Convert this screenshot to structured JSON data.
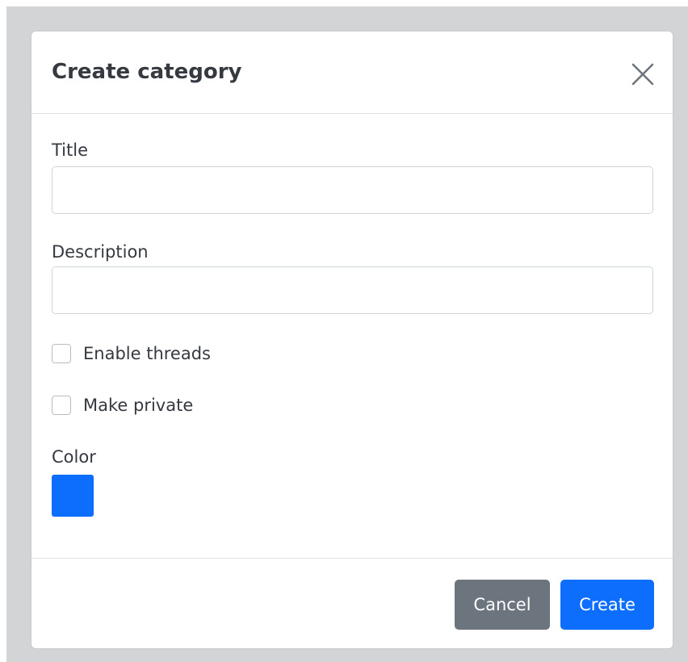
{
  "dialog": {
    "title": "Create category",
    "close_icon": "close-icon"
  },
  "form": {
    "title_label": "Title",
    "title_value": "",
    "description_label": "Description",
    "description_value": "",
    "enable_threads_label": "Enable threads",
    "enable_threads_checked": false,
    "make_private_label": "Make private",
    "make_private_checked": false,
    "color_label": "Color",
    "color_value": "#0d6efd"
  },
  "footer": {
    "cancel_label": "Cancel",
    "create_label": "Create"
  },
  "colors": {
    "backdrop": "#d3d4d5",
    "primary": "#0d6efd",
    "secondary": "#6c757d"
  }
}
